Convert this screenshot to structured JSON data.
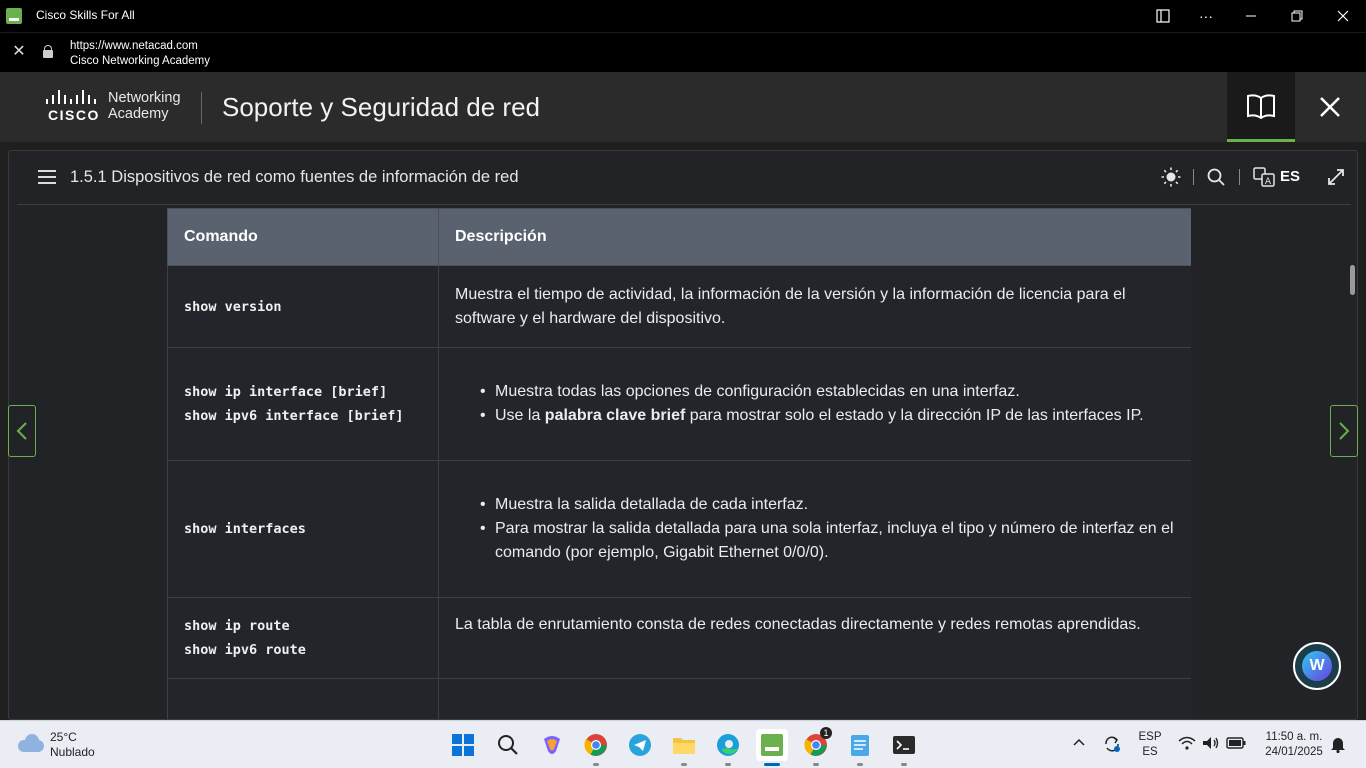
{
  "window": {
    "title": "Cisco Skills For All",
    "controls": [
      "app-options",
      "more-options",
      "minimize",
      "restore",
      "close"
    ]
  },
  "urlbar": {
    "url": "https://www.netacad.com",
    "site_name": "Cisco Networking Academy"
  },
  "header": {
    "logo_word": "CISCO",
    "brand_line1": "Networking",
    "brand_line2": "Academy",
    "course_title": "Soporte y Seguridad de red",
    "accent_color": "#6ab04c"
  },
  "topic": {
    "title": "1.5.1 Dispositivos de red como fuentes de información de red",
    "language": "ES"
  },
  "table": {
    "headers": [
      "Comando",
      "Descripción"
    ],
    "rows": [
      {
        "commands": [
          "show version"
        ],
        "description": "Muestra el tiempo de actividad, la información de la versión y la información de licencia para el software y el hardware del dispositivo."
      },
      {
        "commands": [
          "show ip interface [brief]",
          "show ipv6 interface [brief]"
        ],
        "bullets": [
          "Muestra todas las opciones de configuración establecidas en una interfaz.",
          {
            "before": "Use la ",
            "bold": "palabra clave brief",
            "after": " para mostrar solo el estado y la dirección IP de las interfaces IP."
          }
        ]
      },
      {
        "commands": [
          "show interfaces"
        ],
        "bullets": [
          "Muestra la salida detallada de cada interfaz.",
          "Para mostrar la salida detallada para una sola interfaz, incluya el tipo y número de interfaz en el comando (por ejemplo, Gigabit Ethernet 0/0/0)."
        ]
      },
      {
        "commands": [
          "show ip route",
          "show ipv6 route"
        ],
        "description": "La tabla de enrutamiento consta de redes conectadas directamente y redes remotas aprendidas."
      }
    ]
  },
  "taskbar": {
    "weather_temp": "25°C",
    "weather_desc": "Nublado",
    "language_line1": "ESP",
    "language_line2": "ES",
    "time": "11:50 a. m.",
    "date": "24/01/2025",
    "notification_badge": "1",
    "apps": [
      "start",
      "search",
      "copilot",
      "chrome",
      "telegram",
      "file-explorer",
      "edge",
      "skills-for-all",
      "chrome-profile",
      "notepad",
      "terminal"
    ]
  }
}
